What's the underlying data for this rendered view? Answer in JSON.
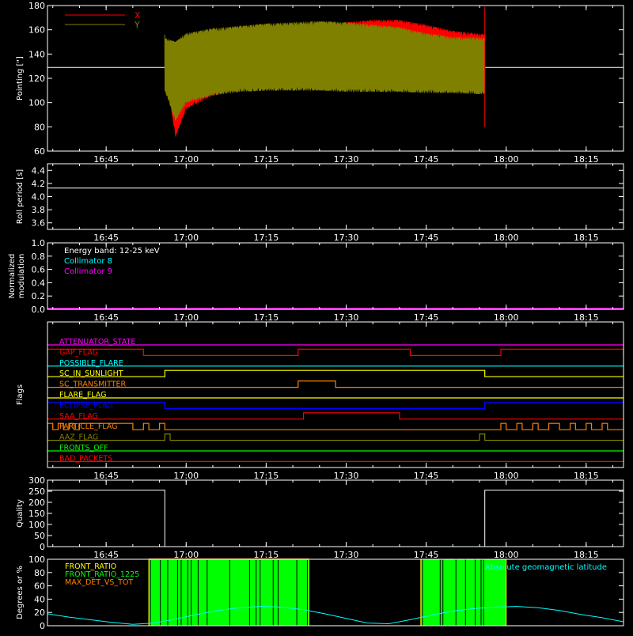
{
  "chart_data": [
    {
      "type": "line",
      "id": "pointing",
      "ylabel": "Pointing [\"]",
      "xlim": [
        "16:34",
        "18:22"
      ],
      "ylim": [
        60,
        180
      ],
      "xticks": [
        "16:45",
        "17:00",
        "17:15",
        "17:30",
        "17:45",
        "18:00",
        "18:15"
      ],
      "yticks": [
        60,
        80,
        100,
        120,
        140,
        160,
        180
      ],
      "legend": {
        "placement": "top-left",
        "entries": [
          {
            "name": "X",
            "color": "#ff0000"
          },
          {
            "name": "Y",
            "color": "#808000"
          }
        ]
      },
      "reference_line": {
        "y": 129,
        "color": "#ffffff"
      },
      "data_range": [
        "16:56",
        "17:56"
      ],
      "series": [
        {
          "name": "X",
          "color": "#ff0000",
          "x": [
            "16:56",
            "16:58",
            "17:00",
            "17:05",
            "17:10",
            "17:15",
            "17:20",
            "17:25",
            "17:30",
            "17:35",
            "17:40",
            "17:45",
            "17:50",
            "17:56"
          ],
          "upper": [
            146,
            148,
            150,
            154,
            157,
            159,
            160,
            162,
            166,
            168,
            168,
            164,
            159,
            156
          ],
          "lower": [
            128,
            72,
            95,
            106,
            111,
            115,
            117,
            119,
            121,
            123,
            124,
            126,
            128,
            130
          ]
        },
        {
          "name": "Y",
          "color": "#808000",
          "x": [
            "16:56",
            "16:58",
            "17:00",
            "17:05",
            "17:10",
            "17:15",
            "17:20",
            "17:25",
            "17:30",
            "17:35",
            "17:40",
            "17:45",
            "17:50",
            "17:56"
          ],
          "upper": [
            153,
            150,
            157,
            161,
            163,
            165,
            166,
            167,
            166,
            164,
            162,
            157,
            154,
            153
          ],
          "lower": [
            110,
            85,
            100,
            106,
            109,
            110,
            110,
            110,
            109,
            109,
            109,
            108,
            108,
            107
          ]
        }
      ]
    },
    {
      "type": "line",
      "id": "roll",
      "ylabel": "Roll period [s]",
      "xlim": [
        "16:34",
        "18:22"
      ],
      "ylim": [
        3.5,
        4.5
      ],
      "yticks": [
        3.6,
        3.8,
        4.0,
        4.2,
        4.4
      ],
      "xticks": [
        "16:45",
        "17:00",
        "17:15",
        "17:30",
        "17:45",
        "18:00",
        "18:15"
      ],
      "series": [
        {
          "name": "",
          "color": "#ffffff",
          "x": [
            "16:34",
            "18:22"
          ],
          "values": [
            4.13,
            4.13
          ]
        }
      ]
    },
    {
      "type": "line",
      "id": "modulation",
      "ylabel": [
        "Normalized",
        "modulation"
      ],
      "xlim": [
        "16:34",
        "18:22"
      ],
      "ylim": [
        0,
        1
      ],
      "yticks": [
        0.0,
        0.2,
        0.4,
        0.6,
        0.8,
        1.0
      ],
      "xticks": [
        "16:45",
        "17:00",
        "17:15",
        "17:30",
        "17:45",
        "18:00",
        "18:15"
      ],
      "annotations": [
        {
          "text": "Energy band: 12-25 keV",
          "color": "#ffffff"
        },
        {
          "text": "Collimator 8",
          "color": "#00ffff"
        },
        {
          "text": "Collimator 9",
          "color": "#ff00ff"
        }
      ],
      "series": [
        {
          "name": "Collimator 9",
          "color": "#ff00ff",
          "x": [
            "16:34",
            "18:22"
          ],
          "values": [
            0,
            0
          ]
        }
      ]
    },
    {
      "type": "line",
      "id": "flags",
      "ylabel": "Flags",
      "xlim": [
        "16:34",
        "18:22"
      ],
      "xticks": [
        "16:45",
        "17:00",
        "17:15",
        "17:30",
        "17:45",
        "18:00",
        "18:15"
      ],
      "flags": [
        {
          "name": "ATTENUATOR_STATE",
          "color": "#ff00ff",
          "high": []
        },
        {
          "name": "GAP_FLAG",
          "color": "#ff0000",
          "high": [
            [
              "16:34",
              "16:52"
            ],
            [
              "17:21",
              "17:42"
            ],
            [
              "17:59",
              "18:22"
            ]
          ]
        },
        {
          "name": "POSSIBLE_FLARE",
          "color": "#00ffff",
          "high": []
        },
        {
          "name": "SC_IN_SUNLIGHT",
          "color": "#ffff00",
          "high": [
            [
              "16:56",
              "17:56"
            ]
          ]
        },
        {
          "name": "SC_TRANSMITTER",
          "color": "#ff8000",
          "high": [
            [
              "17:21",
              "17:28"
            ]
          ]
        },
        {
          "name": "FLARE_FLAG",
          "color": "#ffff00",
          "high": []
        },
        {
          "name": "ECLIPSE_FLAG",
          "color": "#0000ff",
          "high": [
            [
              "16:34",
              "16:56"
            ],
            [
              "17:56",
              "18:22"
            ]
          ]
        },
        {
          "name": "SAA_FLAG",
          "color": "#ff0000",
          "high": [
            [
              "17:22",
              "17:40"
            ]
          ]
        },
        {
          "name": "PARTICLE_FLAG",
          "color": "#ff8000",
          "high": [
            [
              "16:34",
              "16:35"
            ],
            [
              "16:36",
              "16:37"
            ],
            [
              "16:38",
              "16:39"
            ],
            [
              "16:40",
              "16:50"
            ],
            [
              "16:52",
              "16:53"
            ],
            [
              "16:55",
              "16:56"
            ],
            [
              "17:59",
              "18:00"
            ],
            [
              "18:02",
              "18:03"
            ],
            [
              "18:05",
              "18:06"
            ],
            [
              "18:08",
              "18:10"
            ],
            [
              "18:12",
              "18:13"
            ],
            [
              "18:15",
              "18:16"
            ],
            [
              "18:18",
              "18:19"
            ]
          ]
        },
        {
          "name": "AAZ_FLAG",
          "color": "#808000",
          "high": [
            [
              "16:56",
              "16:57"
            ],
            [
              "17:55",
              "17:56"
            ]
          ]
        },
        {
          "name": "FRONTS_OFF",
          "color": "#00ff00",
          "high": []
        },
        {
          "name": "BAD_PACKETS",
          "color": "#ff0000",
          "high": []
        }
      ]
    },
    {
      "type": "line",
      "id": "quality",
      "ylabel": "Quality",
      "xlim": [
        "16:34",
        "18:22"
      ],
      "ylim": [
        0,
        300
      ],
      "yticks": [
        0,
        50,
        100,
        150,
        200,
        250,
        300
      ],
      "xticks": [
        "16:45",
        "17:00",
        "17:15",
        "17:30",
        "17:45",
        "18:00",
        "18:15"
      ],
      "series": [
        {
          "name": "",
          "color": "#ffffff",
          "x": [
            "16:34",
            "16:56",
            "16:56",
            "17:56",
            "17:56",
            "18:22"
          ],
          "values": [
            255,
            255,
            0,
            0,
            255,
            255
          ]
        }
      ]
    },
    {
      "type": "line",
      "id": "ratios",
      "ylabel": "Degrees or %",
      "xlim": [
        "16:34",
        "18:22"
      ],
      "ylim": [
        0,
        100
      ],
      "yticks": [
        0,
        20,
        40,
        60,
        80,
        100
      ],
      "legend": {
        "placement": "top-left",
        "entries": [
          {
            "name": "FRONT_RATIO",
            "color": "#ffff00"
          },
          {
            "name": "FRONT_RATIO_1225",
            "color": "#00ff00"
          },
          {
            "name": "MAX_DET_VS_TOT",
            "color": "#ff8000"
          }
        ]
      },
      "annotations": [
        {
          "text": "Absolute geomagnetic latitude",
          "color": "#00ffff"
        }
      ],
      "green_bursts": [
        [
          "16:53",
          "17:23"
        ],
        [
          "17:44",
          "18:00"
        ]
      ],
      "series": [
        {
          "name": "Absolute geomagnetic latitude",
          "color": "#00ffff",
          "x": [
            "16:34",
            "16:38",
            "16:42",
            "16:46",
            "16:50",
            "16:54",
            "16:58",
            "17:02",
            "17:06",
            "17:10",
            "17:14",
            "17:18",
            "17:22",
            "17:26",
            "17:30",
            "17:34",
            "17:38",
            "17:42",
            "17:46",
            "17:50",
            "17:54",
            "17:58",
            "18:02",
            "18:06",
            "18:10",
            "18:14",
            "18:18",
            "18:22"
          ],
          "values": [
            18,
            13,
            9,
            5,
            2,
            4,
            10,
            17,
            23,
            27,
            29,
            28,
            24,
            18,
            11,
            4,
            3,
            9,
            16,
            22,
            26,
            28,
            29,
            27,
            23,
            17,
            12,
            6
          ]
        }
      ]
    }
  ]
}
